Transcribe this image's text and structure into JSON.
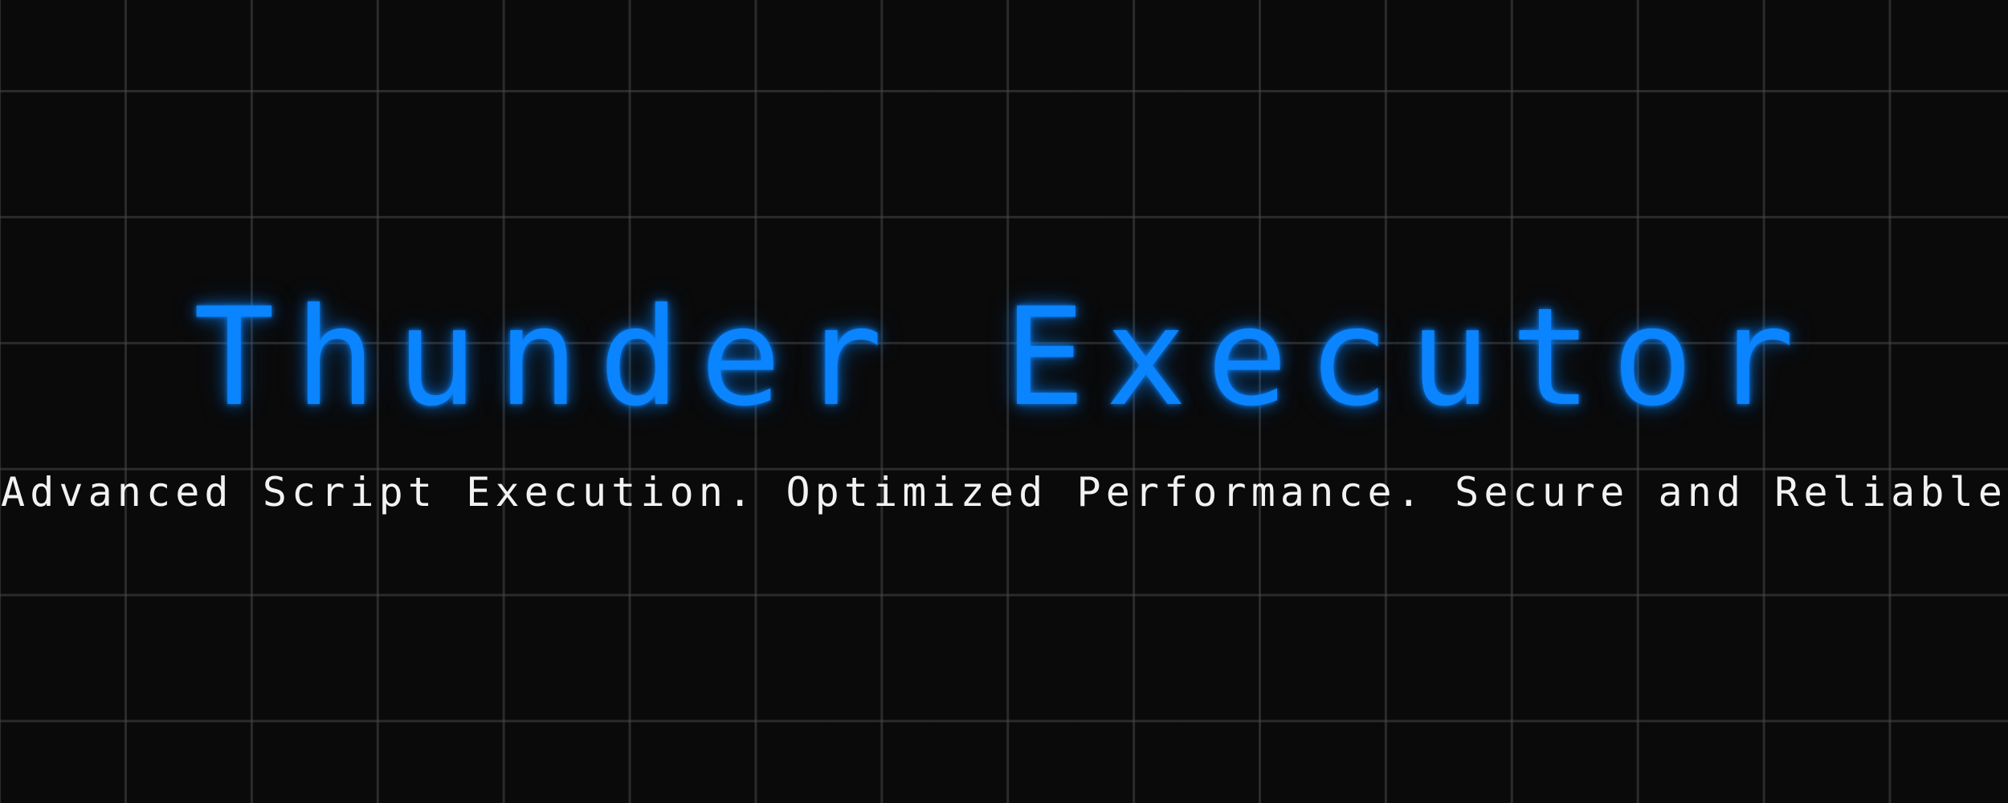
{
  "banner": {
    "title": "Thunder Executor",
    "tagline": "Advanced Script Execution. Optimized Performance. Secure and Reliable"
  },
  "colors": {
    "background": "#0a0a0a",
    "grid": "#464646",
    "accent": "#0a84ff",
    "text": "#f2f2f2"
  }
}
